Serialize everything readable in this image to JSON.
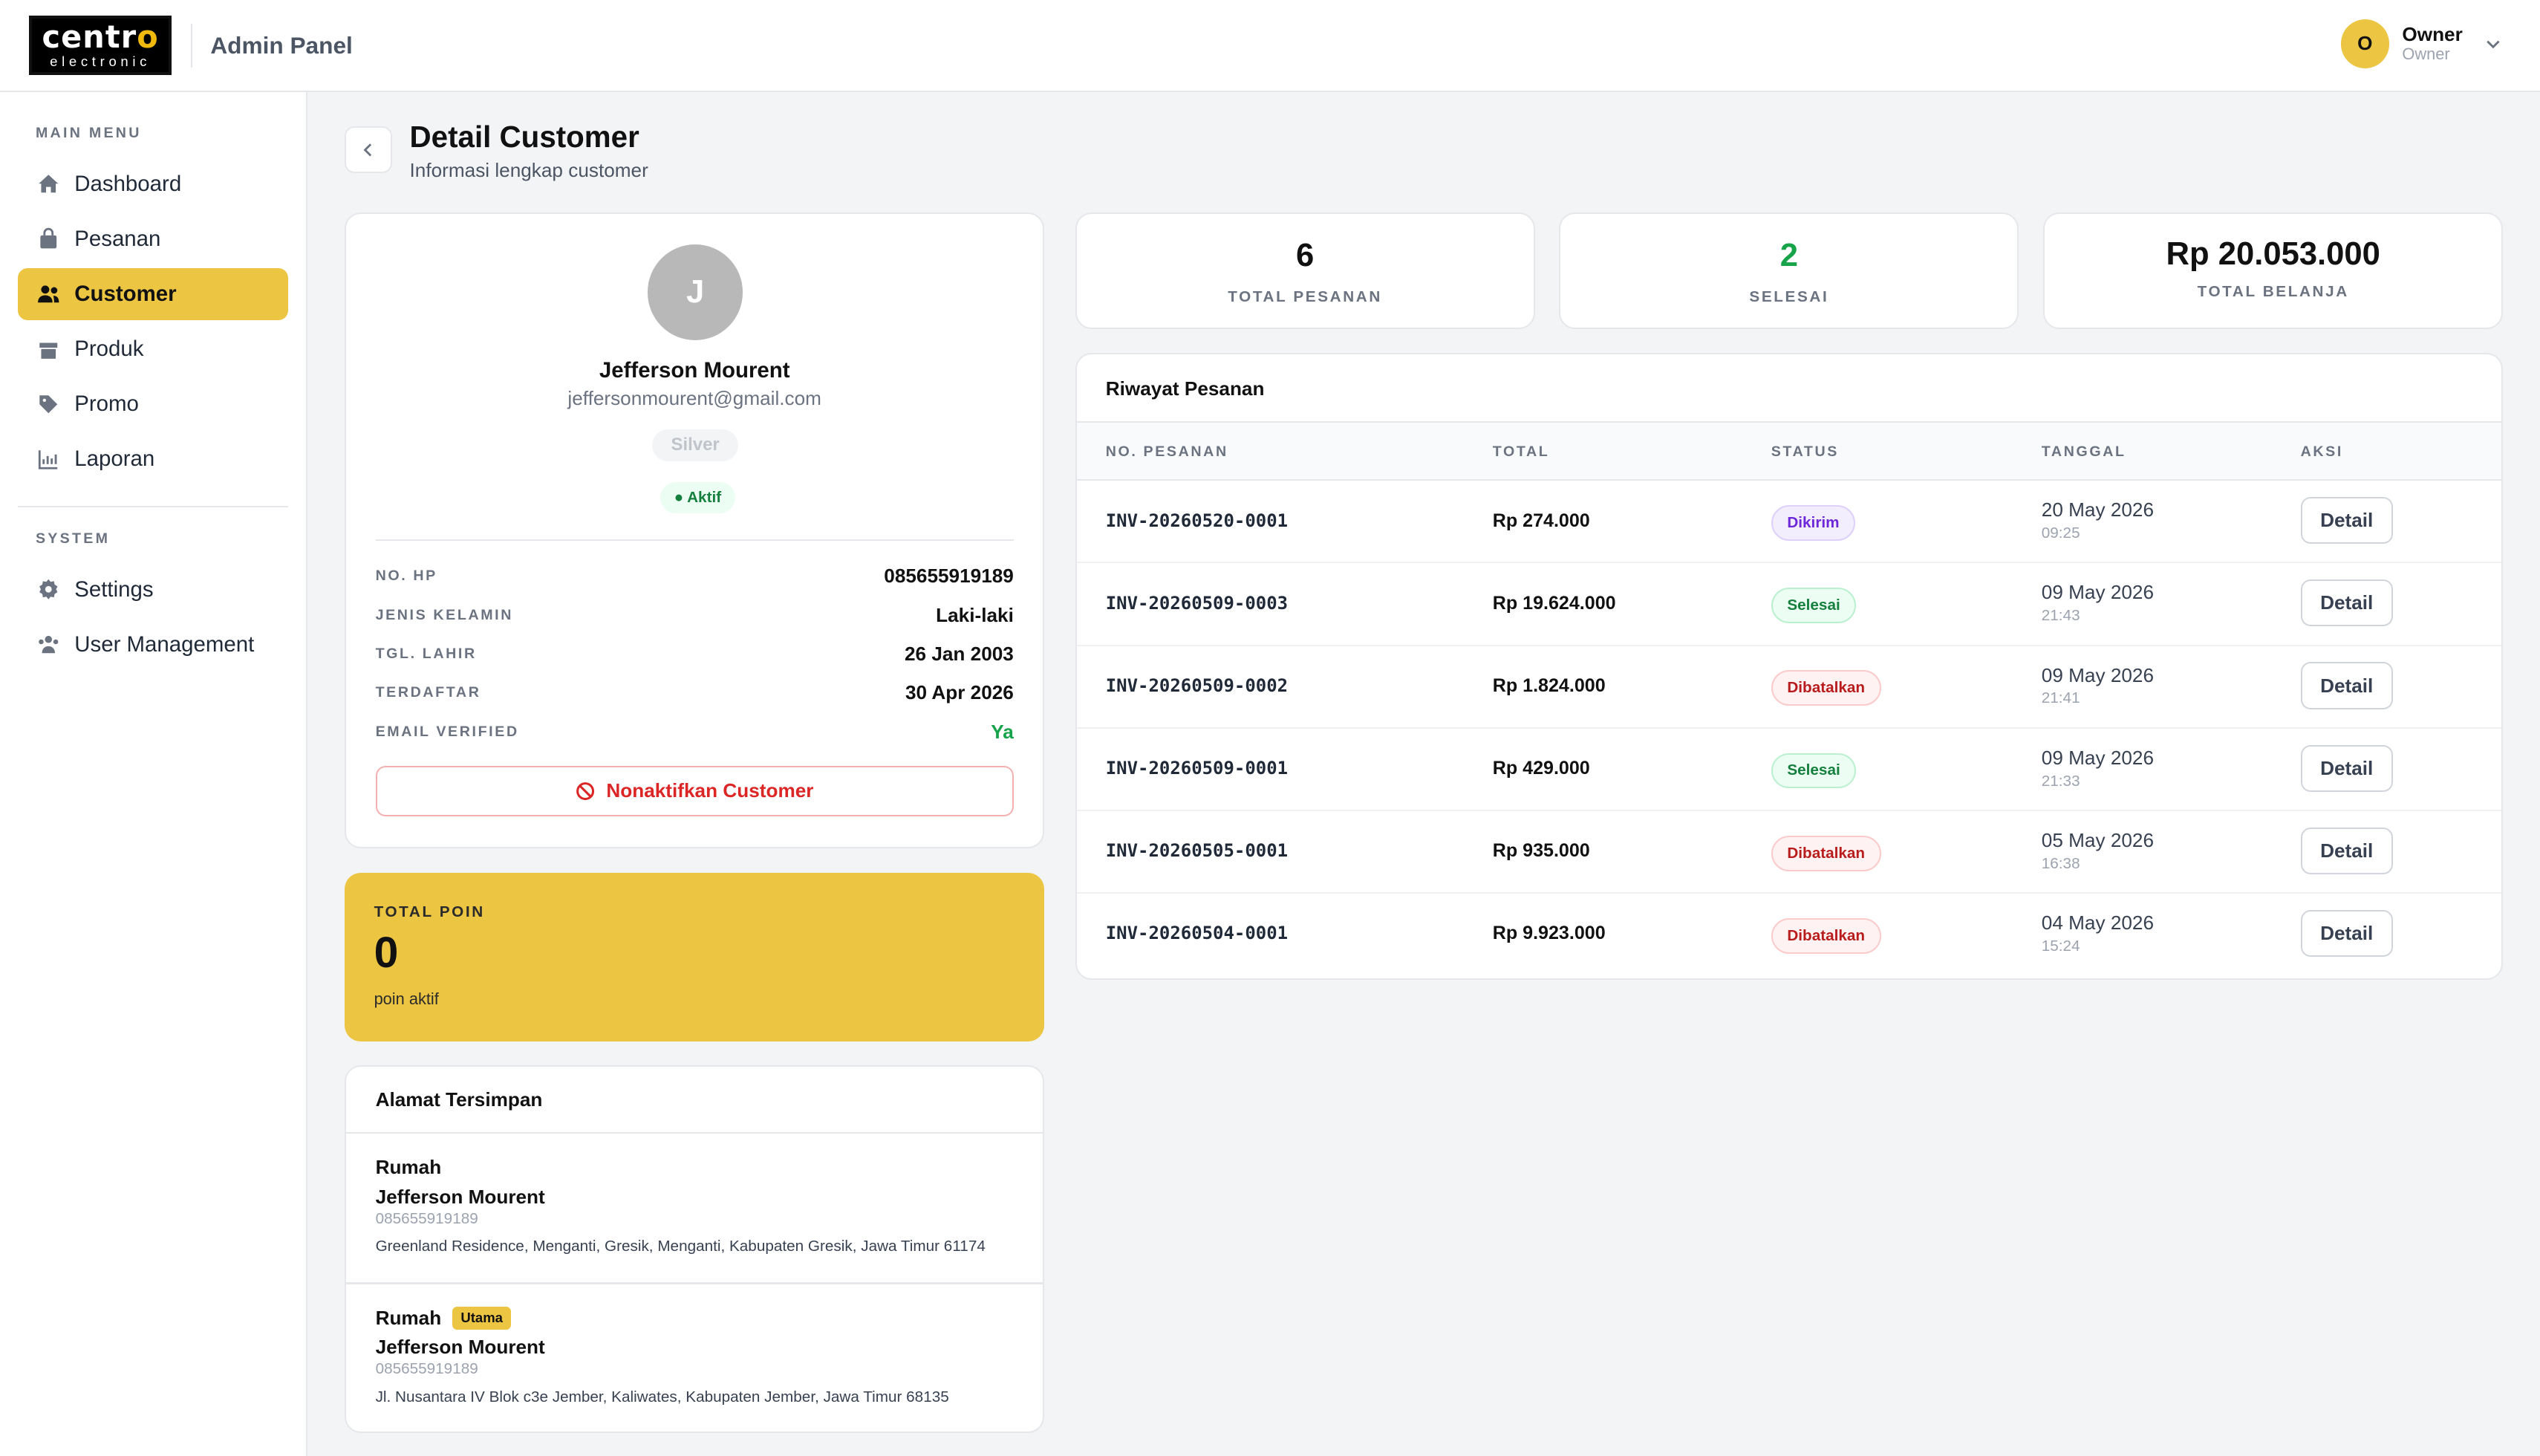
{
  "header": {
    "logo_top": "centro",
    "logo_bottom": "electronic",
    "app_title": "Admin Panel",
    "user_initial": "O",
    "user_name": "Owner",
    "user_role": "Owner"
  },
  "sidebar": {
    "main_menu_label": "MAIN MENU",
    "system_label": "SYSTEM",
    "main_items": [
      {
        "label": "Dashboard",
        "icon": "home-icon"
      },
      {
        "label": "Pesanan",
        "icon": "bag-icon"
      },
      {
        "label": "Customer",
        "icon": "users-icon",
        "active": true
      },
      {
        "label": "Produk",
        "icon": "box-icon"
      },
      {
        "label": "Promo",
        "icon": "tag-icon"
      },
      {
        "label": "Laporan",
        "icon": "chart-icon"
      }
    ],
    "system_items": [
      {
        "label": "Settings",
        "icon": "gear-icon"
      },
      {
        "label": "User Management",
        "icon": "user-group-icon"
      }
    ]
  },
  "page": {
    "title": "Detail Customer",
    "subtitle": "Informasi lengkap customer"
  },
  "profile": {
    "initial": "J",
    "name": "Jefferson Mourent",
    "email": "jeffersonmourent@gmail.com",
    "tier": "Silver",
    "status": "● Aktif",
    "fields": [
      {
        "label": "NO. HP",
        "value": "085655919189"
      },
      {
        "label": "JENIS KELAMIN",
        "value": "Laki-laki"
      },
      {
        "label": "TGL. LAHIR",
        "value": "26 Jan 2003"
      },
      {
        "label": "TERDAFTAR",
        "value": "30 Apr 2026"
      },
      {
        "label": "EMAIL VERIFIED",
        "value": "Ya"
      }
    ],
    "deactivate_label": "Nonaktifkan Customer"
  },
  "points": {
    "label": "TOTAL POIN",
    "value": "0",
    "sub": "poin aktif"
  },
  "addresses": {
    "title": "Alamat Tersimpan",
    "items": [
      {
        "label": "Rumah",
        "badge": "",
        "name": "Jefferson Mourent",
        "phone": "085655919189",
        "address": "Greenland Residence, Menganti, Gresik, Menganti, Kabupaten Gresik, Jawa Timur 61174"
      },
      {
        "label": "Rumah",
        "badge": "Utama",
        "name": "Jefferson Mourent",
        "phone": "085655919189",
        "address": "Jl. Nusantara IV Blok c3e Jember, Kaliwates, Kabupaten Jember, Jawa Timur 68135"
      }
    ]
  },
  "stats": [
    {
      "value": "6",
      "label": "TOTAL PESANAN"
    },
    {
      "value": "2",
      "label": "SELESAI"
    },
    {
      "value": "Rp 20.053.000",
      "label": "TOTAL BELANJA"
    }
  ],
  "orders": {
    "title": "Riwayat Pesanan",
    "columns": [
      "NO. PESANAN",
      "TOTAL",
      "STATUS",
      "TANGGAL",
      "AKSI"
    ],
    "detail_label": "Detail",
    "rows": [
      {
        "invoice": "INV-20260520-0001",
        "total": "Rp 274.000",
        "status": "Dikirim",
        "date": "20 May 2026",
        "time": "09:25"
      },
      {
        "invoice": "INV-20260509-0003",
        "total": "Rp 19.624.000",
        "status": "Selesai",
        "date": "09 May 2026",
        "time": "21:43"
      },
      {
        "invoice": "INV-20260509-0002",
        "total": "Rp 1.824.000",
        "status": "Dibatalkan",
        "date": "09 May 2026",
        "time": "21:41"
      },
      {
        "invoice": "INV-20260509-0001",
        "total": "Rp 429.000",
        "status": "Selesai",
        "date": "09 May 2026",
        "time": "21:33"
      },
      {
        "invoice": "INV-20260505-0001",
        "total": "Rp 935.000",
        "status": "Dibatalkan",
        "date": "05 May 2026",
        "time": "16:38"
      },
      {
        "invoice": "INV-20260504-0001",
        "total": "Rp 9.923.000",
        "status": "Dibatalkan",
        "date": "04 May 2026",
        "time": "15:24"
      }
    ]
  },
  "colors": {
    "accent": "#ecc543",
    "success": "#16a34a",
    "danger": "#dc2626",
    "shipped": "#6d28d9"
  }
}
